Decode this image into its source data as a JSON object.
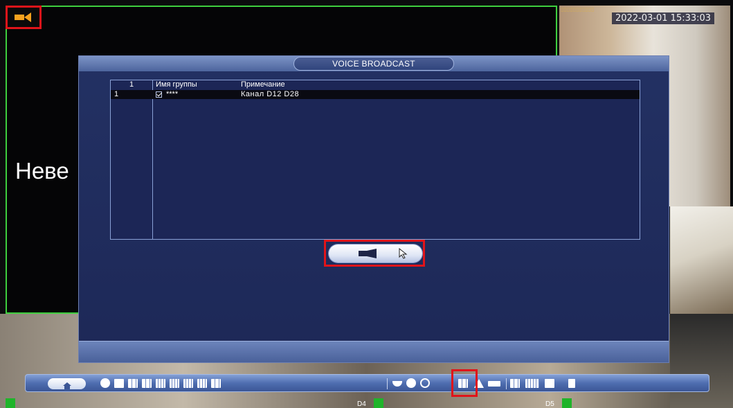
{
  "camera": {
    "timestamp": "2022-03-01 15:33:03",
    "overlay_text": "Неве",
    "channel_labels": [
      "D4",
      "D5"
    ]
  },
  "dialog": {
    "title": "VOICE BROADCAST",
    "table": {
      "headers": [
        "1",
        "Имя группы",
        "Примечание"
      ],
      "rows": [
        {
          "index": "1",
          "group_name": "****",
          "checked": true,
          "note": "Канал D12 D28"
        }
      ]
    },
    "broadcast_button_icon": "megaphone-icon"
  },
  "taskbar": {
    "icons": [
      "home-icon",
      "back-icon",
      "layout-1-icon",
      "layout-4-icon",
      "layout-6-icon",
      "layout-8-icon",
      "layout-9-icon",
      "layout-16-icon",
      "layout-25-icon",
      "layout-custom-icon",
      "ptz-icon",
      "color-icon",
      "search-icon",
      "voice-broadcast-icon",
      "alarm-icon",
      "record-icon",
      "network-icon",
      "hdd-icon",
      "display-icon",
      "usb-icon"
    ]
  },
  "colors": {
    "highlight": "#e0141a",
    "dialog_bg": "#1d2857",
    "alarm_icon": "#f6a21e"
  }
}
